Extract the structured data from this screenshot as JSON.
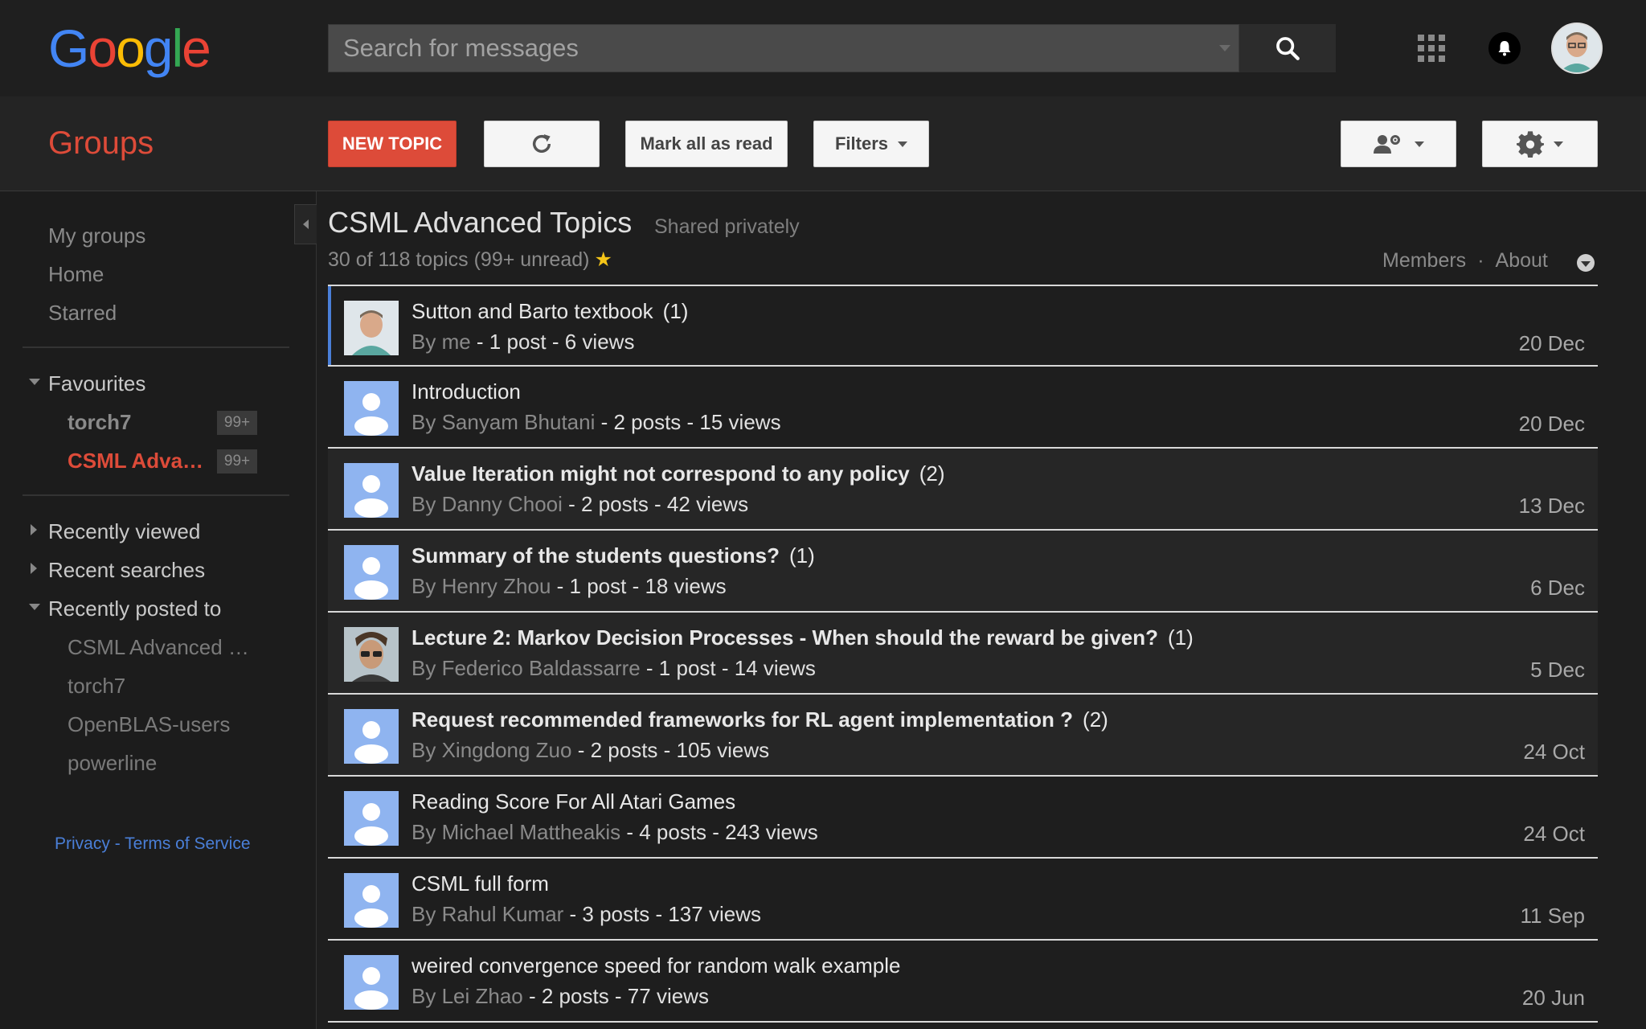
{
  "logo": "Google",
  "search": {
    "placeholder": "Search for messages"
  },
  "toolbar": {
    "title": "Groups",
    "new_topic": "NEW TOPIC",
    "mark_all": "Mark all as read",
    "filters": "Filters"
  },
  "sidebar": {
    "nav": [
      "My groups",
      "Home",
      "Starred"
    ],
    "favourites_label": "Favourites",
    "favourites": [
      {
        "label": "torch7",
        "badge": "99+"
      },
      {
        "label": "CSML Adva…",
        "badge": "99+"
      }
    ],
    "recently_viewed": "Recently viewed",
    "recent_searches": "Recent searches",
    "recently_posted": "Recently posted to",
    "posted_items": [
      "CSML Advanced …",
      "torch7",
      "OpenBLAS-users",
      "powerline"
    ],
    "privacy": "Privacy",
    "sep": " - ",
    "terms": "Terms of Service"
  },
  "group": {
    "name": "CSML Advanced Topics",
    "sharing": "Shared privately",
    "count": "30 of 118 topics (99+ unread)",
    "members": "Members",
    "dot": "·",
    "about": "About"
  },
  "topics": [
    {
      "title": "Sutton and Barto textbook",
      "count": "(1)",
      "author": "me",
      "stats": " - 1 post - 6 views",
      "date": "20 Dec"
    },
    {
      "title": "Introduction",
      "count": "",
      "author": "Sanyam Bhutani",
      "stats": " - 2 posts - 15 views",
      "date": "20 Dec"
    },
    {
      "title": "Value Iteration might not correspond to any policy",
      "count": "(2)",
      "author": "Danny Chooi",
      "stats": " - 2 posts - 42 views",
      "date": "13 Dec"
    },
    {
      "title": "Summary of the students questions?",
      "count": "(1)",
      "author": "Henry Zhou",
      "stats": " - 1 post - 18 views",
      "date": "6 Dec"
    },
    {
      "title": "Lecture 2: Markov Decision Processes - When should the reward be given?",
      "count": "(1)",
      "author": "Federico Baldassarre",
      "stats": " - 1 post - 14 views",
      "date": "5 Dec"
    },
    {
      "title": "Request recommended frameworks for RL agent implementation ?",
      "count": "(2)",
      "author": "Xingdong Zuo",
      "stats": " - 2 posts - 105 views",
      "date": "24 Oct"
    },
    {
      "title": "Reading Score For All Atari Games",
      "count": "",
      "author": "Michael Mattheakis",
      "stats": " - 4 posts - 243 views",
      "date": "24 Oct"
    },
    {
      "title": "CSML full form",
      "count": "",
      "author": "Rahul Kumar",
      "stats": " - 3 posts - 137 views",
      "date": "11 Sep"
    },
    {
      "title": "weired convergence speed for random walk example",
      "count": "",
      "author": "Lei Zhao",
      "stats": " - 2 posts - 77 views",
      "date": "20 Jun"
    }
  ],
  "by_label": "By ",
  "colors": {
    "accent": "#dd4b39",
    "link": "#4a7fd8",
    "avatar_default": "#8fb4f0"
  }
}
